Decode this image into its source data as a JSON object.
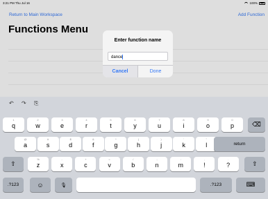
{
  "statusbar": {
    "time": "3:21 PM  Thu Jul 16",
    "battery": "100%"
  },
  "nav": {
    "back": "Return to Main Workspace",
    "add": "Add Function"
  },
  "page": {
    "title": "Functions Menu"
  },
  "dialog": {
    "title": "Enter function name",
    "input_value": "dance",
    "cancel": "Cancel",
    "done": "Done"
  },
  "toolbar": {
    "undo": "↶",
    "redo": "↷",
    "paste": "⎘"
  },
  "keys": {
    "row1": [
      {
        "k": "q",
        "s": "1"
      },
      {
        "k": "w",
        "s": "2"
      },
      {
        "k": "e",
        "s": "3"
      },
      {
        "k": "r",
        "s": "4"
      },
      {
        "k": "t",
        "s": "5"
      },
      {
        "k": "y",
        "s": "6"
      },
      {
        "k": "u",
        "s": "7"
      },
      {
        "k": "i",
        "s": "8"
      },
      {
        "k": "o",
        "s": "9"
      },
      {
        "k": "p",
        "s": "0"
      }
    ],
    "delete": "⌫",
    "row2": [
      {
        "k": "a",
        "s": "@"
      },
      {
        "k": "s",
        "s": "#"
      },
      {
        "k": "d",
        "s": "$"
      },
      {
        "k": "f",
        "s": "&"
      },
      {
        "k": "g",
        "s": "*"
      },
      {
        "k": "h",
        "s": "("
      },
      {
        "k": "j",
        "s": ")"
      },
      {
        "k": "k",
        "s": "'"
      },
      {
        "k": "l",
        "s": "\""
      }
    ],
    "return": "return",
    "shift": "⇧",
    "row3": [
      {
        "k": "z",
        "s": "%"
      },
      {
        "k": "x",
        "s": "-"
      },
      {
        "k": "c",
        "s": "+"
      },
      {
        "k": "v",
        "s": "="
      },
      {
        "k": "b",
        "s": "/"
      },
      {
        "k": "n",
        "s": ";"
      },
      {
        "k": "m",
        "s": ":"
      },
      {
        "k": "!",
        "s": ","
      },
      {
        "k": "?",
        "s": "."
      }
    ],
    "numbers": ".?123",
    "emoji": "☺",
    "mic": "🎙",
    "numbers_right": ".?123",
    "dismiss": "⌨"
  }
}
